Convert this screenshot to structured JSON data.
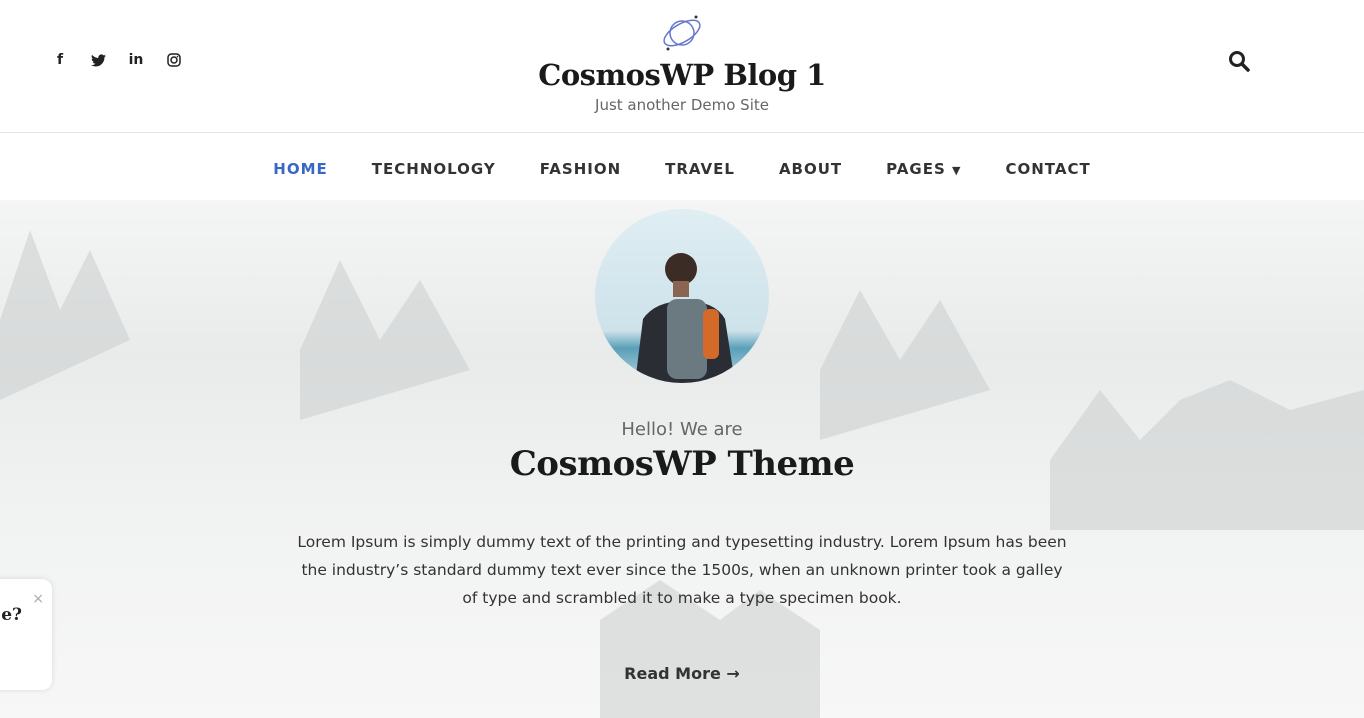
{
  "site": {
    "title": "CosmosWP Blog 1",
    "tagline": "Just another Demo Site"
  },
  "social": [
    "facebook-icon",
    "twitter-icon",
    "linkedin-icon",
    "instagram-icon"
  ],
  "nav": [
    {
      "label": "HOME",
      "active": true
    },
    {
      "label": "TECHNOLOGY"
    },
    {
      "label": "FASHION"
    },
    {
      "label": "TRAVEL"
    },
    {
      "label": "ABOUT"
    },
    {
      "label": "PAGES",
      "dropdown": true
    },
    {
      "label": "CONTACT"
    }
  ],
  "hero": {
    "greeting": "Hello! We are",
    "heading": "CosmosWP Theme",
    "description": "Lorem Ipsum is simply dummy text of the printing and typesetting industry. Lorem Ipsum has been the industry’s standard dummy text ever since the 1500s, when an unknown printer took a galley of type and scrambled it to make a type specimen book.",
    "read_more": "Read More"
  },
  "popup": {
    "text": "e?",
    "close": "×"
  },
  "colors": {
    "accent": "#3a66c4"
  }
}
